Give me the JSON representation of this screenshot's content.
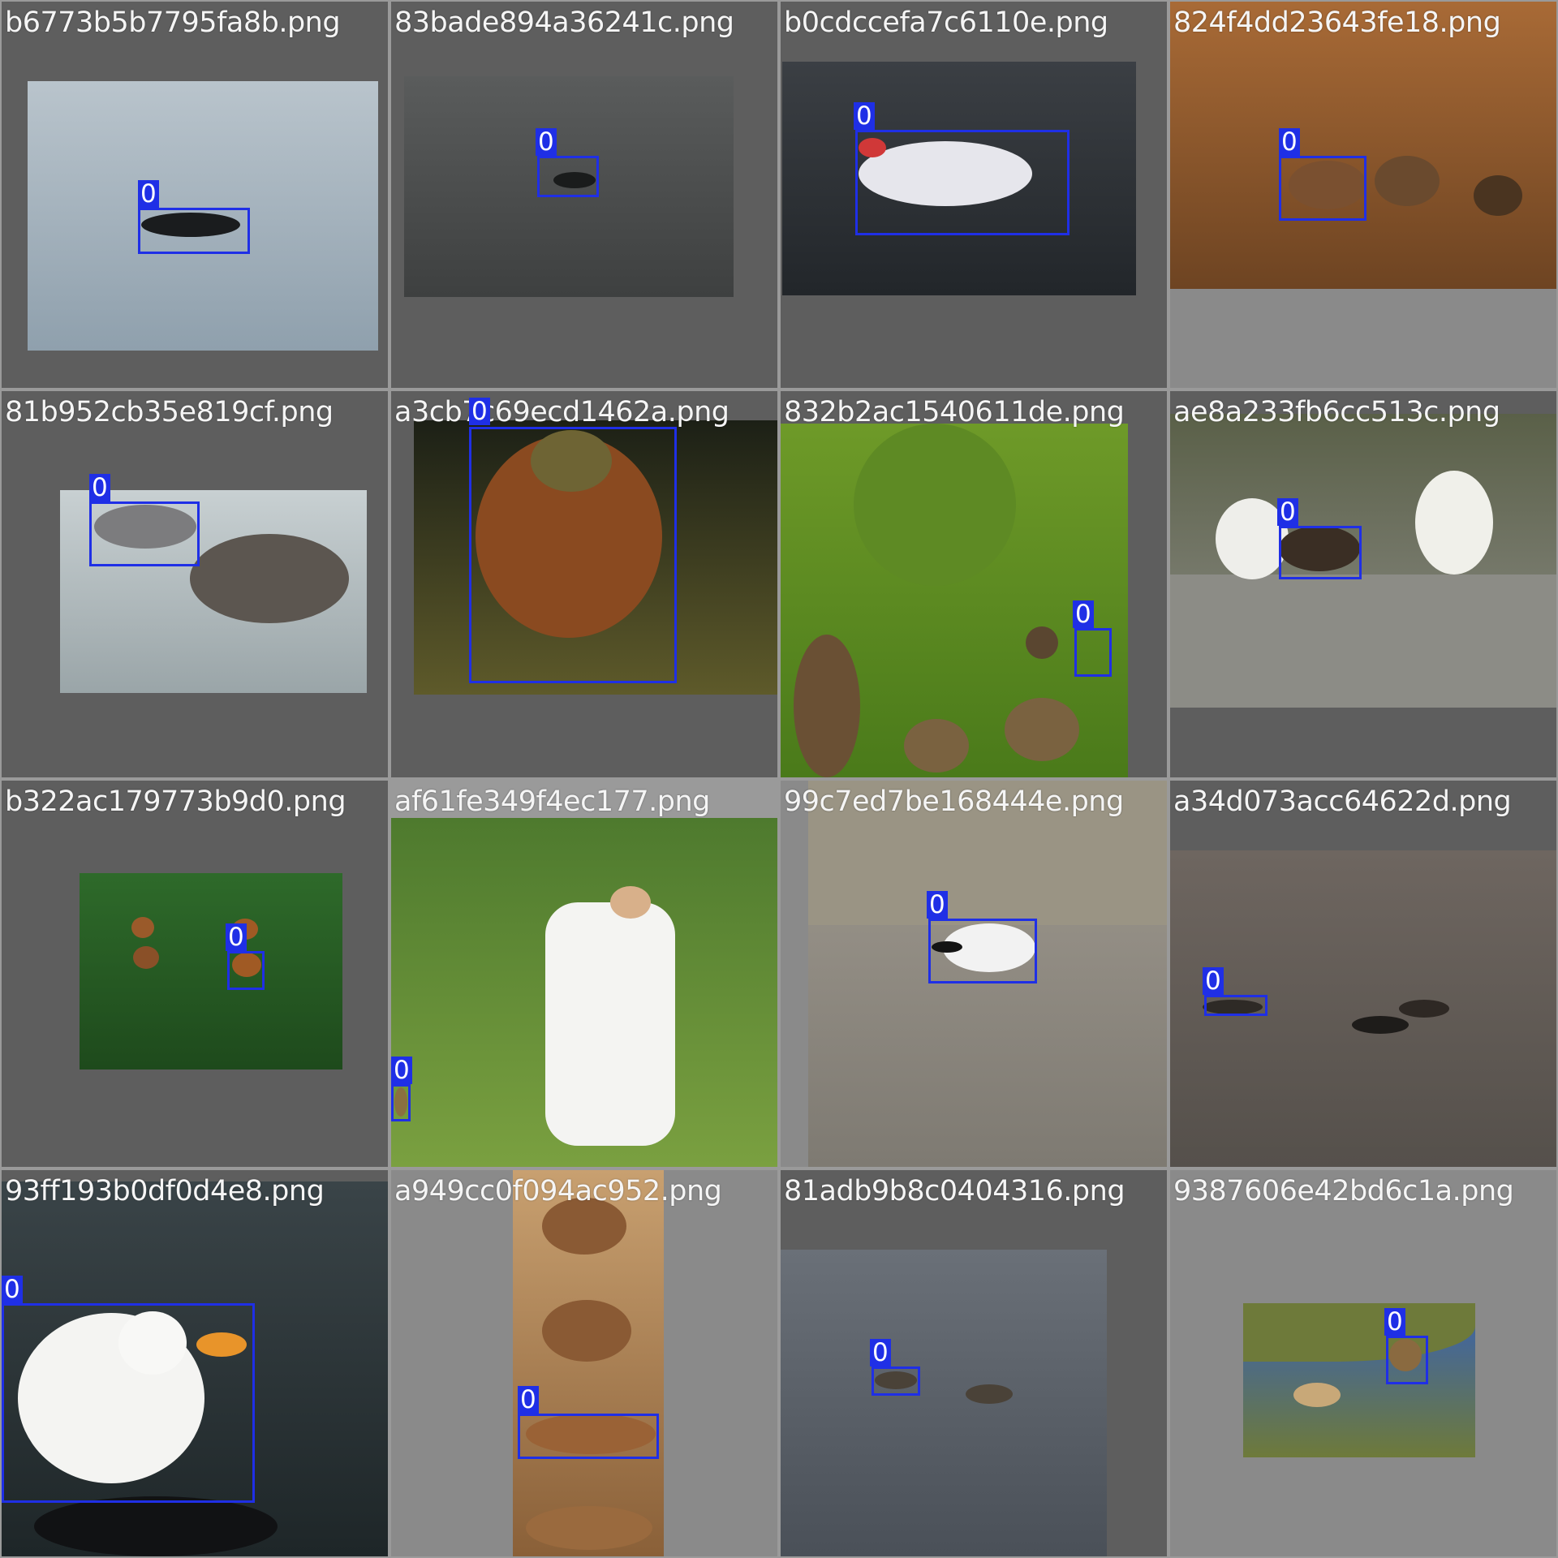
{
  "tiles": [
    {
      "filename": "b6773b5b7795fa8b.png",
      "bg": "#5e5e5e",
      "photo": "#b9c4cc",
      "photo_alt": "#8fa0ad",
      "boxes": [
        {
          "label": "0"
        }
      ]
    },
    {
      "filename": "83bade894a36241c.png",
      "bg": "#5e5e5e",
      "photo": "#5a5c5c",
      "photo_alt": "#3e4040",
      "boxes": [
        {
          "label": "0"
        }
      ]
    },
    {
      "filename": "b0cdccefa7c6110e.png",
      "bg": "#5e5e5e",
      "photo": "#3b3f44",
      "photo_alt": "#22262a",
      "boxes": [
        {
          "label": "0"
        }
      ]
    },
    {
      "filename": "824f4dd23643fe18.png",
      "bg": "#8a8a8a",
      "photo": "#a86a36",
      "photo_alt": "#6e4422",
      "boxes": [
        {
          "label": "0"
        }
      ]
    },
    {
      "filename": "81b952cb35e819cf.png",
      "bg": "#5e5e5e",
      "photo": "#c8d0d2",
      "photo_alt": "#9aa5a8",
      "boxes": [
        {
          "label": "0"
        }
      ]
    },
    {
      "filename": "a3cb7c69ecd1462a.png",
      "bg": "#5e5e5e",
      "photo": "#1c2016",
      "photo_alt": "#5e5a2a",
      "boxes": [
        {
          "label": "0"
        }
      ]
    },
    {
      "filename": "832b2ac1540611de.png",
      "bg": "#5e5e5e",
      "photo": "#6e9a28",
      "photo_alt": "#4a7a1a",
      "boxes": [
        {
          "label": "0"
        }
      ]
    },
    {
      "filename": "ae8a233fb6cc513c.png",
      "bg": "#5e5e5e",
      "photo": "#5a6048",
      "photo_alt": "#8c8c86",
      "boxes": [
        {
          "label": "0"
        }
      ]
    },
    {
      "filename": "b322ac179773b9d0.png",
      "bg": "#5e5e5e",
      "photo": "#2e6a2a",
      "photo_alt": "#1e4a1c",
      "boxes": [
        {
          "label": "0"
        }
      ]
    },
    {
      "filename": "af61fe349f4ec177.png",
      "bg": "#9a9a9a",
      "photo": "#4e7a2e",
      "photo_alt": "#7aa040",
      "boxes": [
        {
          "label": "0"
        }
      ]
    },
    {
      "filename": "99c7ed7be168444e.png",
      "bg": "#8a8a8a",
      "photo": "#a09a90",
      "photo_alt": "#7e7a72",
      "boxes": [
        {
          "label": "0"
        }
      ]
    },
    {
      "filename": "a34d073acc64622d.png",
      "bg": "#5e5e5e",
      "photo": "#6e6660",
      "photo_alt": "#55504b",
      "boxes": [
        {
          "label": "0"
        }
      ]
    },
    {
      "filename": "93ff193b0df0d4e8.png",
      "bg": "#5e5e5e",
      "photo": "#3a4448",
      "photo_alt": "#1e2628",
      "boxes": [
        {
          "label": "0"
        }
      ]
    },
    {
      "filename": "a949cc0f094ac952.png",
      "bg": "#8a8a8a",
      "photo": "#c8a070",
      "photo_alt": "#8a6038",
      "boxes": [
        {
          "label": "0"
        }
      ]
    },
    {
      "filename": "81adb9b8c0404316.png",
      "bg": "#5e5e5e",
      "photo": "#6a7078",
      "photo_alt": "#4a5058",
      "boxes": [
        {
          "label": "0"
        }
      ]
    },
    {
      "filename": "9387606e42bd6c1a.png",
      "bg": "#8a8a8a",
      "photo": "#3a62b0",
      "photo_alt": "#6e7a3a",
      "boxes": [
        {
          "label": "0"
        }
      ]
    }
  ]
}
